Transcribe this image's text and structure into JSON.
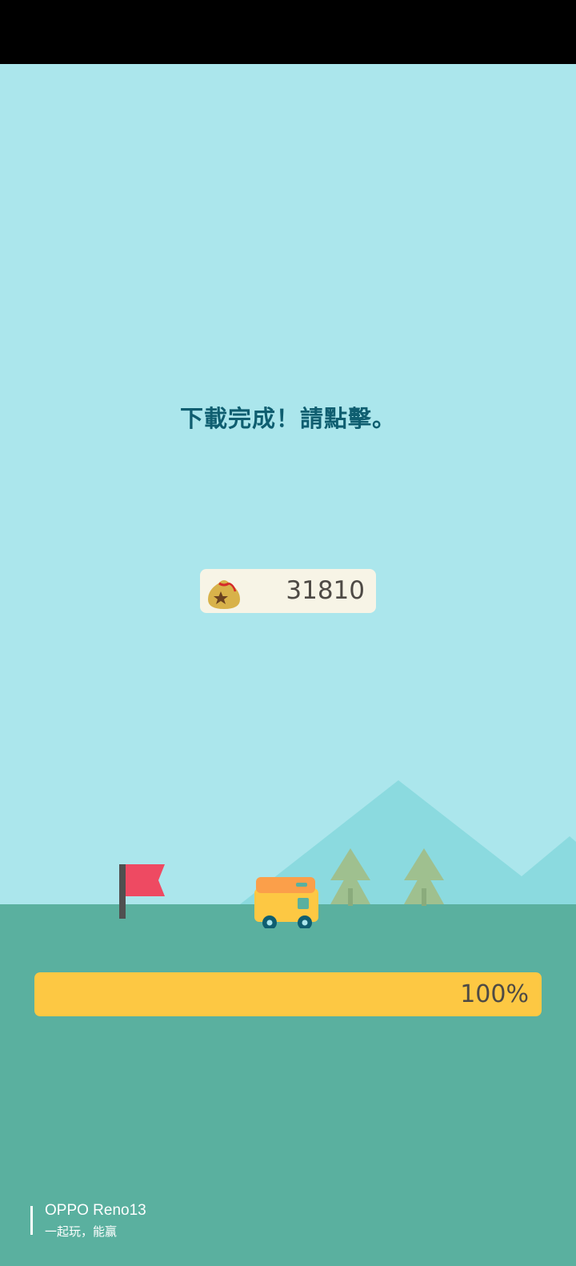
{
  "screen": {
    "message": "下載完成！請點擊。",
    "currency": {
      "icon": "money-bag-icon",
      "value": "31810"
    },
    "progress": {
      "label": "100%",
      "fraction": 1.0
    }
  },
  "scene": {
    "icons": [
      "flag-icon",
      "camper-van-icon",
      "tree-icon",
      "mountain-icon"
    ]
  },
  "watermark": {
    "title": "OPPO Reno13",
    "subtitle": "一起玩，能赢"
  },
  "colors": {
    "sky": "#abe6ec",
    "ground": "#5ab09f",
    "mountain": "#8bdadf",
    "message": "#0f5e70",
    "progress_fill": "#fdc843",
    "flag": "#ee4a62",
    "van": "#fdc843",
    "van_roof": "#fb9f4a"
  }
}
